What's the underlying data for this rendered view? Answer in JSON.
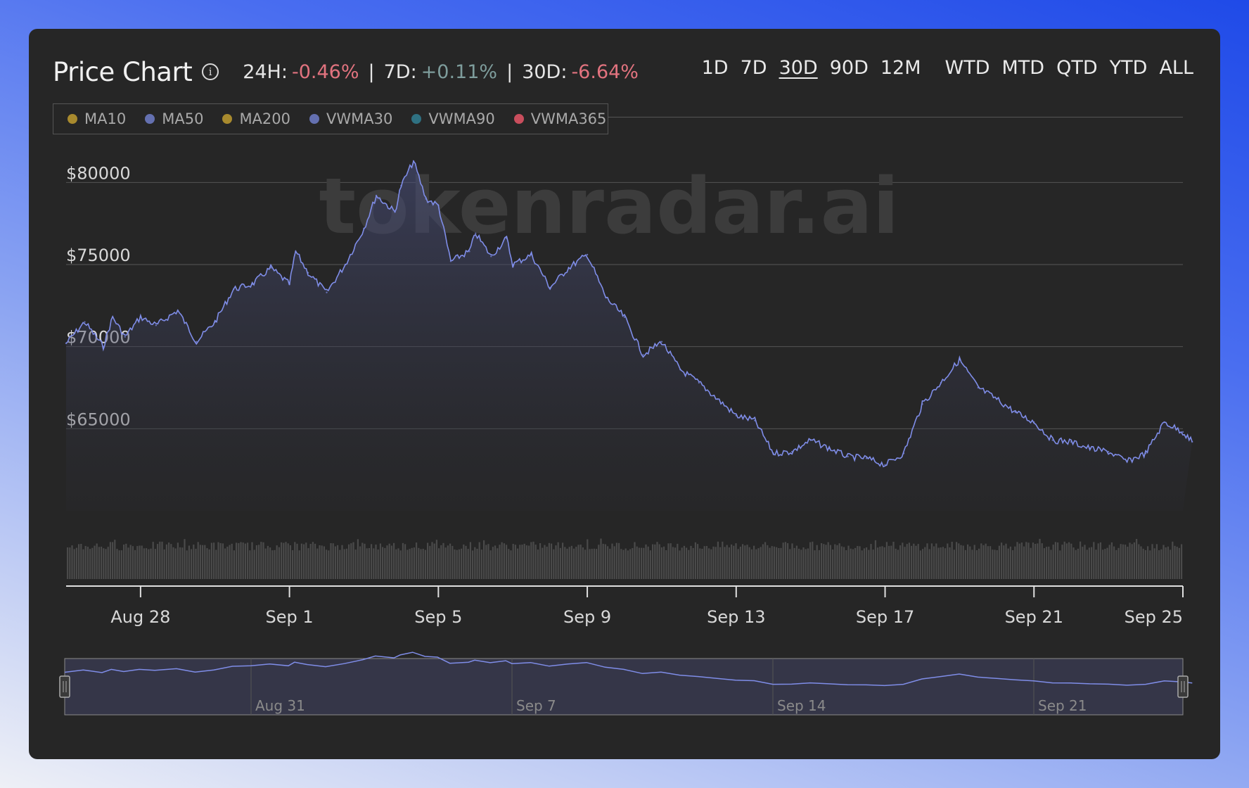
{
  "header": {
    "title": "Price Chart",
    "info_icon": "info-icon",
    "stats": [
      {
        "label": "24H:",
        "value": "-0.46%",
        "trend": "negative"
      },
      {
        "label": "7D:",
        "value": "+0.11%",
        "trend": "positive"
      },
      {
        "label": "30D:",
        "value": "-6.64%",
        "trend": "negative"
      }
    ],
    "separator": "|"
  },
  "ranges": {
    "items": [
      "1D",
      "7D",
      "30D",
      "90D",
      "12M",
      "WTD",
      "MTD",
      "QTD",
      "YTD",
      "ALL"
    ],
    "active": "30D"
  },
  "legend": [
    {
      "name": "MA10",
      "color": "#a88a2e"
    },
    {
      "name": "MA50",
      "color": "#6470b0"
    },
    {
      "name": "MA200",
      "color": "#a88a2e"
    },
    {
      "name": "VWMA30",
      "color": "#6470b0"
    },
    {
      "name": "VWMA90",
      "color": "#2f7182"
    },
    {
      "name": "VWMA365",
      "color": "#c94e5d"
    }
  ],
  "watermark": "tokenradar.ai",
  "colors": {
    "line": "#7f8de8",
    "negative": "#e2737f",
    "positive": "#7e9d9c",
    "volume": "#4a4a4a",
    "grid": "#555555"
  },
  "chart_data": {
    "type": "area",
    "y_ticks": [
      "$65000",
      "$70000",
      "$75000",
      "$80000"
    ],
    "y_tick_values": [
      65000,
      70000,
      75000,
      80000
    ],
    "ylim": [
      60000,
      82500
    ],
    "x_range": [
      "2024-08-26",
      "2024-09-25"
    ],
    "x_ticks": [
      "Aug 28",
      "Sep 1",
      "Sep 5",
      "Sep 9",
      "Sep 13",
      "Sep 17",
      "Sep 21",
      "Sep 25"
    ],
    "x_tick_dates": [
      "2024-08-28",
      "2024-09-01",
      "2024-09-05",
      "2024-09-09",
      "2024-09-13",
      "2024-09-17",
      "2024-09-21",
      "2024-09-25"
    ],
    "series": [
      {
        "values": [
          {
            "date": "2024-08-26",
            "price": 70200
          },
          {
            "date": "2024-08-26T12:00",
            "price": 71500
          },
          {
            "date": "2024-08-27",
            "price": 70000
          },
          {
            "date": "2024-08-27T06:00",
            "price": 71800
          },
          {
            "date": "2024-08-27T14:00",
            "price": 70600
          },
          {
            "date": "2024-08-28",
            "price": 71800
          },
          {
            "date": "2024-08-28T10:00",
            "price": 71300
          },
          {
            "date": "2024-08-29",
            "price": 72200
          },
          {
            "date": "2024-08-29T12:00",
            "price": 70300
          },
          {
            "date": "2024-08-30",
            "price": 71500
          },
          {
            "date": "2024-08-30T12:00",
            "price": 73500
          },
          {
            "date": "2024-08-31",
            "price": 73800
          },
          {
            "date": "2024-08-31T12:00",
            "price": 74800
          },
          {
            "date": "2024-09-01",
            "price": 73800
          },
          {
            "date": "2024-09-01T04:00",
            "price": 75800
          },
          {
            "date": "2024-09-01T12:00",
            "price": 74500
          },
          {
            "date": "2024-09-02",
            "price": 73300
          },
          {
            "date": "2024-09-02T12:00",
            "price": 75000
          },
          {
            "date": "2024-09-03",
            "price": 77200
          },
          {
            "date": "2024-09-03T08:00",
            "price": 79200
          },
          {
            "date": "2024-09-03T20:00",
            "price": 78200
          },
          {
            "date": "2024-09-04",
            "price": 79800
          },
          {
            "date": "2024-09-04T08:00",
            "price": 81300
          },
          {
            "date": "2024-09-04T16:00",
            "price": 79000
          },
          {
            "date": "2024-09-05",
            "price": 78600
          },
          {
            "date": "2024-09-05T08:00",
            "price": 75200
          },
          {
            "date": "2024-09-05T20:00",
            "price": 75800
          },
          {
            "date": "2024-09-06",
            "price": 76900
          },
          {
            "date": "2024-09-06T10:00",
            "price": 75500
          },
          {
            "date": "2024-09-06T20:00",
            "price": 76600
          },
          {
            "date": "2024-09-07",
            "price": 75000
          },
          {
            "date": "2024-09-07T12:00",
            "price": 75600
          },
          {
            "date": "2024-09-08",
            "price": 73600
          },
          {
            "date": "2024-09-08T12:00",
            "price": 74800
          },
          {
            "date": "2024-09-09",
            "price": 75600
          },
          {
            "date": "2024-09-09T12:00",
            "price": 73000
          },
          {
            "date": "2024-09-10",
            "price": 71800
          },
          {
            "date": "2024-09-10T12:00",
            "price": 69500
          },
          {
            "date": "2024-09-11",
            "price": 70300
          },
          {
            "date": "2024-09-11T12:00",
            "price": 68600
          },
          {
            "date": "2024-09-12",
            "price": 67800
          },
          {
            "date": "2024-09-12T12:00",
            "price": 66800
          },
          {
            "date": "2024-09-13",
            "price": 65800
          },
          {
            "date": "2024-09-13T12:00",
            "price": 65500
          },
          {
            "date": "2024-09-14",
            "price": 63500
          },
          {
            "date": "2024-09-14T12:00",
            "price": 63600
          },
          {
            "date": "2024-09-15",
            "price": 64300
          },
          {
            "date": "2024-09-15T12:00",
            "price": 63800
          },
          {
            "date": "2024-09-16",
            "price": 63300
          },
          {
            "date": "2024-09-16T12:00",
            "price": 63200
          },
          {
            "date": "2024-09-17",
            "price": 62800
          },
          {
            "date": "2024-09-17T12:00",
            "price": 63500
          },
          {
            "date": "2024-09-18",
            "price": 66500
          },
          {
            "date": "2024-09-18T12:00",
            "price": 67800
          },
          {
            "date": "2024-09-19",
            "price": 69200
          },
          {
            "date": "2024-09-19T12:00",
            "price": 67500
          },
          {
            "date": "2024-09-20",
            "price": 66800
          },
          {
            "date": "2024-09-20T12:00",
            "price": 66000
          },
          {
            "date": "2024-09-21",
            "price": 65400
          },
          {
            "date": "2024-09-21T12:00",
            "price": 64300
          },
          {
            "date": "2024-09-22",
            "price": 64200
          },
          {
            "date": "2024-09-22T12:00",
            "price": 63800
          },
          {
            "date": "2024-09-23",
            "price": 63600
          },
          {
            "date": "2024-09-23T12:00",
            "price": 63000
          },
          {
            "date": "2024-09-24",
            "price": 63500
          },
          {
            "date": "2024-09-24T12:00",
            "price": 65400
          },
          {
            "date": "2024-09-25",
            "price": 64800
          },
          {
            "date": "2024-09-25T06:00",
            "price": 64200
          }
        ]
      }
    ],
    "volume_range": [
      0.6,
      1.0
    ],
    "navigator": {
      "labels": [
        "Aug 31",
        "Sep 7",
        "Sep 14",
        "Sep 21"
      ],
      "label_dates": [
        "2024-08-31",
        "2024-09-07",
        "2024-09-14",
        "2024-09-21"
      ],
      "selection": [
        "2024-08-26",
        "2024-09-25"
      ]
    },
    "grid": true,
    "legend_position": "top-left"
  }
}
